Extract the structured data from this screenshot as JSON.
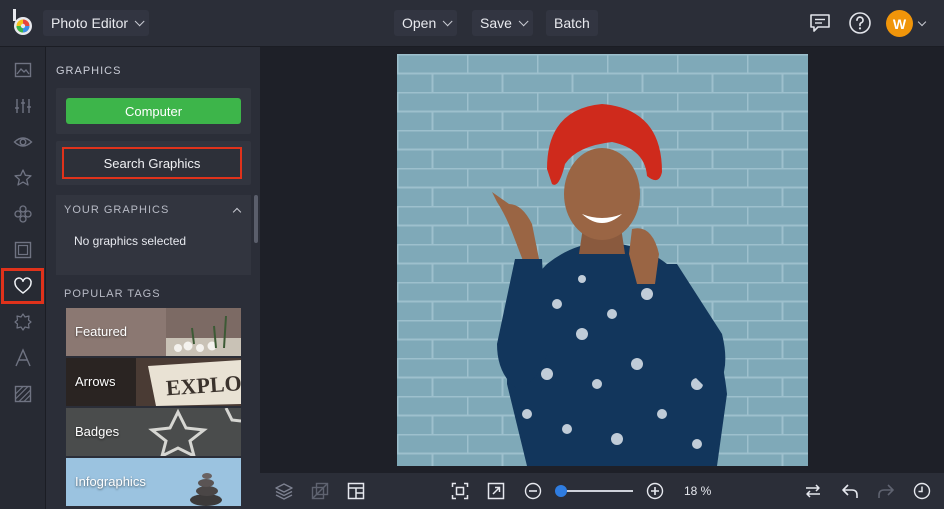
{
  "header": {
    "app_name": "Photo Editor",
    "menus": [
      "Open",
      "Save",
      "Batch"
    ],
    "avatar_letter": "W"
  },
  "panel": {
    "title": "GRAPHICS",
    "computer_button": "Computer",
    "search_button": "Search Graphics",
    "your_graphics_label": "YOUR GRAPHICS",
    "no_graphics_text": "No graphics selected",
    "popular_tags_label": "POPULAR TAGS",
    "tags": [
      "Featured",
      "Arrows",
      "Badges",
      "Infographics"
    ]
  },
  "zoom": {
    "value_label": "18 %",
    "level": 0.05
  },
  "colors": {
    "accent_green": "#3db54a",
    "highlight_red": "#e0321b",
    "avatar_orange": "#f0950a",
    "slider_blue": "#2f7de1"
  },
  "icons": {
    "rail": [
      "image-icon",
      "adjustments-icon",
      "eye-icon",
      "star-icon",
      "effects-icon",
      "frame-icon",
      "heart-icon",
      "shape-icon",
      "text-icon",
      "texture-icon"
    ],
    "bottom": [
      "layers-icon",
      "crop-overlay-icon",
      "layout-icon",
      "fit-screen-icon",
      "expand-icon",
      "zoom-out-icon",
      "zoom-in-icon",
      "flip-icon",
      "undo-icon",
      "redo-icon",
      "history-icon"
    ]
  }
}
